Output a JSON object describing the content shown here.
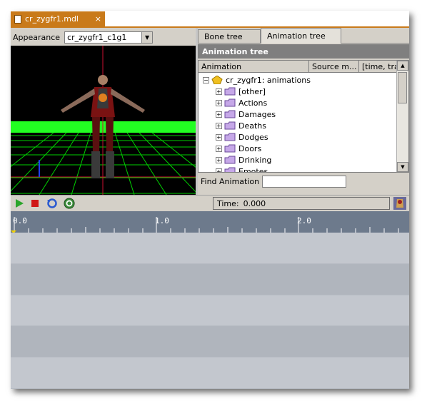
{
  "document_tab": {
    "title": "cr_zygfr1.mdl",
    "close_glyph": "×"
  },
  "appearance": {
    "label": "Appearance",
    "selected": "cr_zygfr1_c1g1"
  },
  "right_tabs": [
    {
      "label": "Bone tree"
    },
    {
      "label": "Animation tree"
    }
  ],
  "animation_tree": {
    "header": "Animation tree",
    "columns": [
      "Animation",
      "Source m...",
      "[time, trans,"
    ],
    "root": "cr_zygfr1: animations",
    "items": [
      "[other]",
      "Actions",
      "Damages",
      "Deaths",
      "Dodges",
      "Doors",
      "Drinking",
      "Emotes"
    ]
  },
  "find": {
    "label": "Find Animation",
    "value": ""
  },
  "transport": {
    "time_label": "Time:",
    "time_value": "0.000"
  },
  "timeline": {
    "ruler_labels": [
      "0.0",
      "1.0",
      "2.0"
    ]
  },
  "colors": {
    "accent": "#c97a1a",
    "ground_grid": "#00ff00",
    "ruler": "#6d7a8c"
  },
  "icons": [
    "file-icon",
    "close-icon",
    "dropdown-arrow-icon",
    "folder-icon",
    "play-icon",
    "stop-icon",
    "loop-icon",
    "refresh-icon",
    "app-badge-icon"
  ]
}
